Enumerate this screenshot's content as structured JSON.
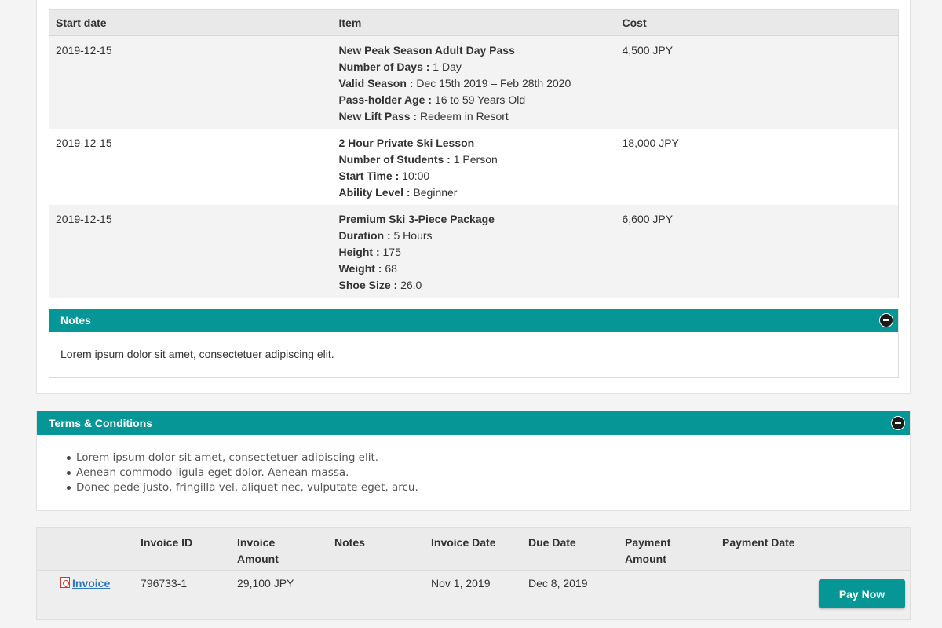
{
  "items_table": {
    "headers": {
      "start_date": "Start date",
      "item": "Item",
      "cost": "Cost"
    },
    "rows": [
      {
        "start_date": "2019-12-15",
        "title": "New Peak Season Adult Day Pass",
        "details": [
          {
            "label": "Number of Days :",
            "value": " 1 Day"
          },
          {
            "label": "Valid Season :",
            "value": " Dec 15th 2019 – Feb 28th 2020"
          },
          {
            "label": "Pass-holder Age :",
            "value": " 16 to 59 Years Old"
          },
          {
            "label": "New Lift Pass :",
            "value": " Redeem in Resort"
          }
        ],
        "cost": "4,500 JPY"
      },
      {
        "start_date": "2019-12-15",
        "title": "2 Hour Private Ski Lesson",
        "details": [
          {
            "label": "Number of Students :",
            "value": " 1 Person"
          },
          {
            "label": "Start Time :",
            "value": " 10:00"
          },
          {
            "label": "Ability Level :",
            "value": " Beginner"
          }
        ],
        "cost": "18,000 JPY"
      },
      {
        "start_date": "2019-12-15",
        "title": "Premium Ski 3-Piece Package",
        "details": [
          {
            "label": "Duration :",
            "value": " 5 Hours"
          },
          {
            "label": "Height :",
            "value": " 175"
          },
          {
            "label": "Weight :",
            "value": " 68"
          },
          {
            "label": "Shoe Size :",
            "value": " 26.0"
          }
        ],
        "cost": "6,600 JPY"
      }
    ]
  },
  "notes_panel": {
    "title": "Notes",
    "text": "Lorem ipsum dolor sit amet, consectetuer adipiscing elit."
  },
  "terms_panel": {
    "title": "Terms & Conditions",
    "items": [
      "Lorem ipsum dolor sit amet, consectetuer adipiscing elit.",
      "Aenean commodo ligula eget dolor. Aenean massa.",
      "Donec pede justo, fringilla vel, aliquet nec, vulputate eget, arcu."
    ]
  },
  "invoice_table": {
    "headers": {
      "invoice_id": "Invoice ID",
      "invoice_amount": "Invoice Amount",
      "notes": "Notes",
      "invoice_date": "Invoice Date",
      "due_date": "Due Date",
      "payment_amount": "Payment Amount",
      "payment_date": "Payment Date"
    },
    "row": {
      "link_label": "Invoice",
      "invoice_id": "796733-1",
      "invoice_amount": "29,100 JPY",
      "notes": "",
      "invoice_date": "Nov 1, 2019",
      "due_date": "Dec 8, 2019",
      "payment_amount": "",
      "payment_date": ""
    },
    "pay_button_label": "Pay Now"
  },
  "colors": {
    "accent": "#079696",
    "link": "#2e79b8"
  }
}
